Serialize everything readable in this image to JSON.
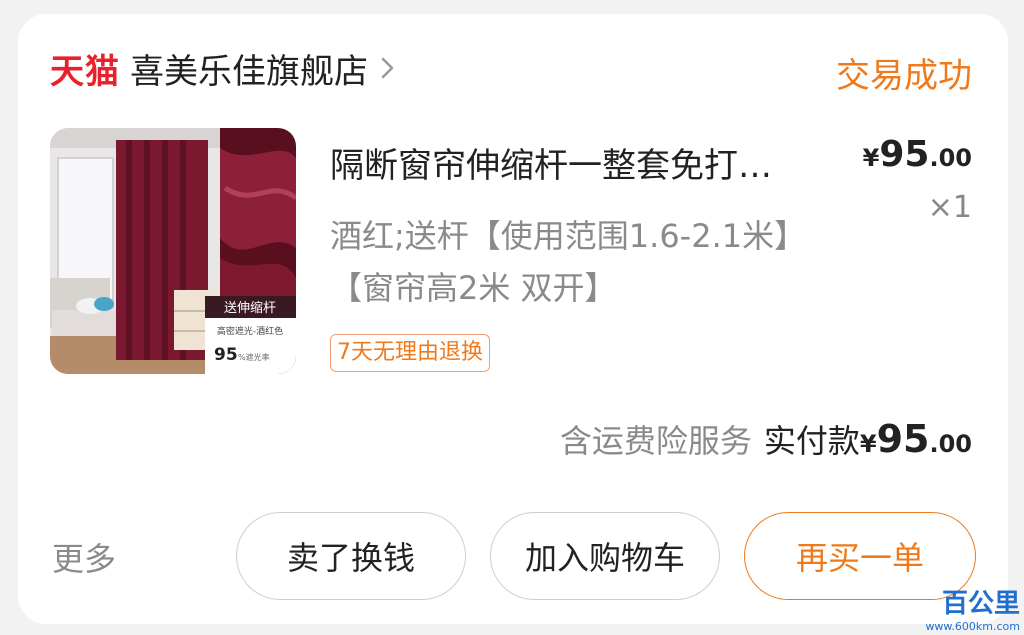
{
  "shop": {
    "platform_logo": "天猫",
    "name": "喜美乐佳旗舰店",
    "status": "交易成功"
  },
  "item": {
    "title": "隔断窗帘伸缩杆一整套免打…",
    "spec": "酒红;送杆【使用范围1.6-2.1米】【窗帘高2米 双开】",
    "badge": "7天无理由退换",
    "price_symbol": "¥",
    "price_int": "95",
    "price_dec": ".00",
    "quantity": "×1",
    "image_overlay": {
      "label": "送伸缩杆",
      "sub": "高密遮光-酒红色",
      "percent": "95",
      "percent_suffix": "%遮光率"
    }
  },
  "summary": {
    "insurance": "含运费险服务",
    "paid_label": "实付款",
    "paid_symbol": "¥",
    "paid_int": "95",
    "paid_dec": ".00"
  },
  "actions": {
    "more": "更多",
    "sell": "卖了换钱",
    "add_cart": "加入购物车",
    "rebuy": "再买一单"
  },
  "watermark": {
    "main": "百公里",
    "sub": "www.600km.com"
  },
  "colors": {
    "tmall_red": "#e8222d",
    "accent_orange": "#f07a1a",
    "curtain_wine": "#7a1830"
  }
}
